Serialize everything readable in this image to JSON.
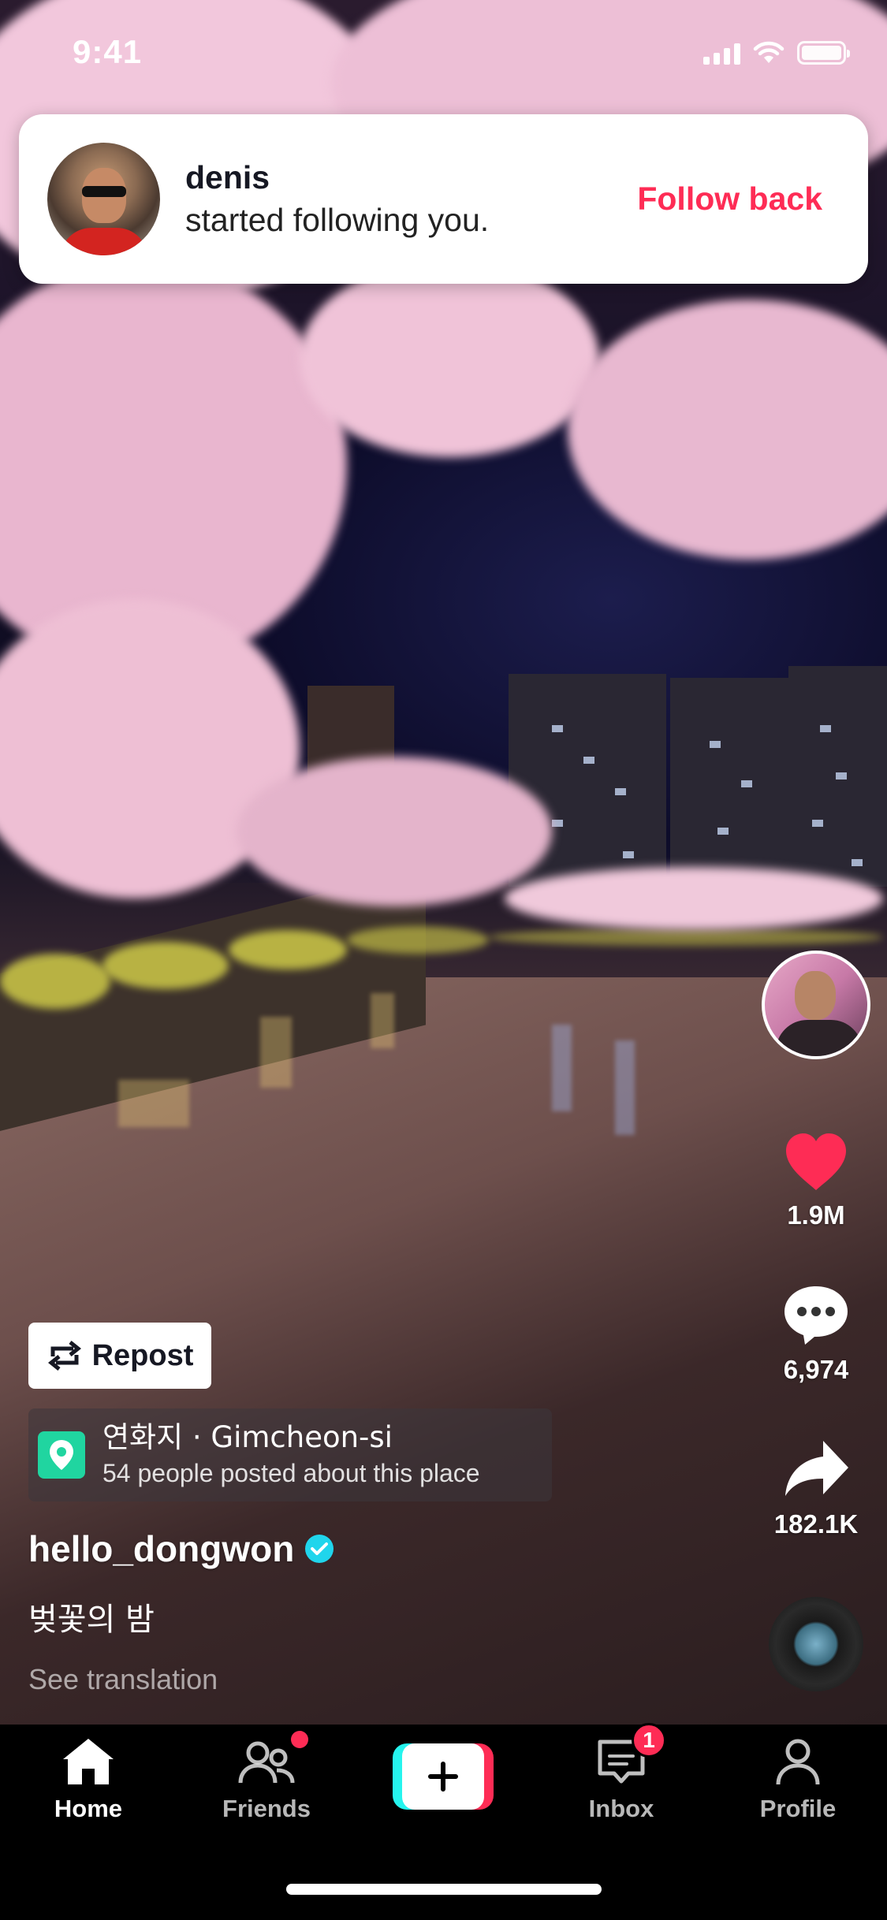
{
  "status_bar": {
    "time": "9:41"
  },
  "notification": {
    "name": "denis",
    "message": "started following you.",
    "action_label": "Follow back"
  },
  "actions": {
    "likes": "1.9M",
    "comments": "6,974",
    "shares": "182.1K"
  },
  "repost": {
    "label": "Repost"
  },
  "location": {
    "title": "연화지 · Gimcheon-si",
    "subtitle": "54 people posted about this place"
  },
  "post": {
    "username": "hello_dongwon",
    "caption": "벚꽃의 밤",
    "translate_label": "See translation"
  },
  "nav": {
    "home": "Home",
    "friends": "Friends",
    "inbox": "Inbox",
    "inbox_badge": "1",
    "profile": "Profile"
  },
  "colors": {
    "accent": "#fe2c55",
    "cyan": "#25f4ee",
    "verified": "#20d5ec",
    "location_icon": "#20d5a0"
  }
}
